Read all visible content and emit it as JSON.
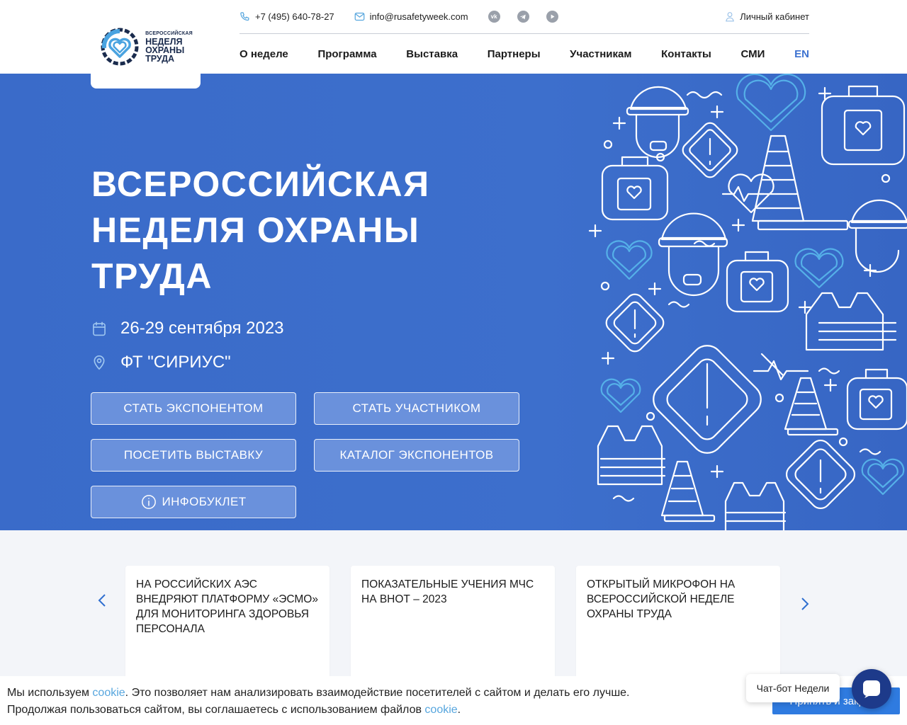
{
  "header": {
    "logo": {
      "small": "ВСЕРОССИЙСКАЯ",
      "line1": "НЕДЕЛЯ",
      "line2": "ОХРАНЫ",
      "line3": "ТРУДА"
    },
    "topbar": {
      "phone": "+7 (495) 640-78-27",
      "email": "info@rusafetyweek.com",
      "social": [
        "vk-icon",
        "telegram-icon",
        "youtube-icon"
      ],
      "cabinet": "Личный кабинет"
    },
    "nav": [
      {
        "label": "О неделе"
      },
      {
        "label": "Программа"
      },
      {
        "label": "Выставка"
      },
      {
        "label": "Партнеры"
      },
      {
        "label": "Участникам"
      },
      {
        "label": "Контакты"
      },
      {
        "label": "СМИ"
      },
      {
        "label": "EN"
      }
    ]
  },
  "hero": {
    "title": "Всероссийская неделя охраны труда",
    "date": "26-29 сентября 2023",
    "place": "ФТ \"СИРИУС\"",
    "buttons": {
      "exhibitor": "СТАТЬ ЭКСПОНЕНТОМ",
      "participant": "СТАТЬ УЧАСТНИКОМ",
      "visit": "ПОСЕТИТЬ ВЫСТАВКУ",
      "catalog": "КАТАЛОГ ЭКСПОНЕНТОВ",
      "booklet": "ИНФОБУКЛЕТ"
    }
  },
  "news": {
    "cards": [
      {
        "title": "НА РОССИЙСКИХ АЭС ВНЕДРЯЮТ ПЛАТФОРМУ «ЭСМО» ДЛЯ МОНИТОРИНГА ЗДОРОВЬЯ ПЕРСОНАЛА"
      },
      {
        "title": "ПОКАЗАТЕЛЬНЫЕ УЧЕНИЯ МЧС НА ВНОТ – 2023"
      },
      {
        "title": "ОТКРЫТЫЙ МИКРОФОН НА ВСЕРОССИЙСКОЙ НЕДЕЛЕ ОХРАНЫ ТРУДА"
      }
    ]
  },
  "cookie": {
    "text1": "Мы используем ",
    "link1": "cookie",
    "text2": ". Это позволяет нам анализировать взаимодействие посетителей с сайтом и делать его лучше.",
    "text3": "Продолжая пользоваться сайтом, вы соглашаетесь с использованием файлов ",
    "link2": "cookie",
    "text4": ".",
    "button": "Принять и закрыть"
  },
  "chat": {
    "tooltip": "Чат-бот Недели"
  },
  "colors": {
    "hero_blue": "#3a6bc9",
    "button_fill": "#6a91dc",
    "accent_link": "#57a6de",
    "cookie_button": "#2f7be0",
    "chat_button": "#1d3a8a"
  }
}
